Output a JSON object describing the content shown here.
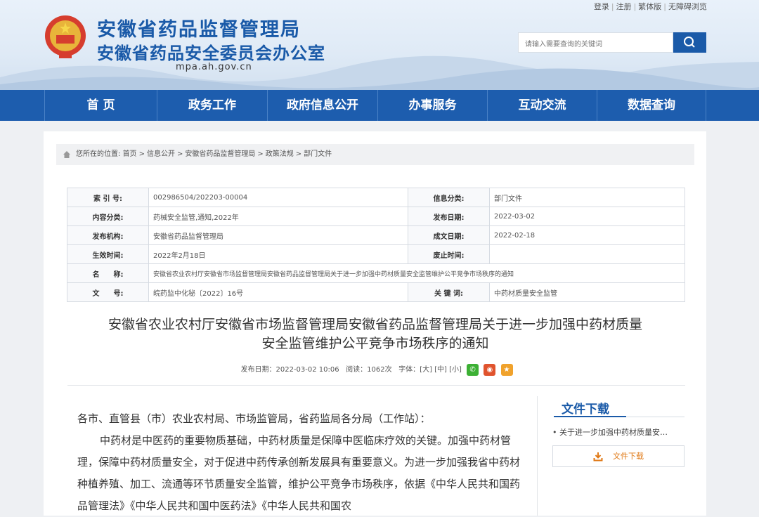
{
  "header": {
    "title": "安徽省药品监督管理局",
    "subtitle": "安徽省药品安全委员会办公室",
    "domain": "mpa.ah.gov.cn",
    "links": [
      "登录",
      "注册",
      "繁体版",
      "无障碍浏览"
    ],
    "search_placeholder": "请输入需要查询的关键词"
  },
  "nav": [
    "首 页",
    "政务工作",
    "政府信息公开",
    "办事服务",
    "互动交流",
    "数据查询"
  ],
  "breadcrumb": {
    "prefix": "您所在的位置:",
    "items": [
      "首页",
      "信息公开",
      "安徽省药品监督管理局",
      "政策法规",
      "部门文件"
    ],
    "sep": ">"
  },
  "info_table": {
    "index_label": "索 引 号:",
    "index_value": "002986504/202203-00004",
    "category_label": "信息分类:",
    "category_value": "部门文件",
    "content_label": "内容分类:",
    "content_value": "药械安全监管,通知,2022年",
    "pubdate_label": "发布日期:",
    "pubdate_value": "2022-03-02",
    "org_label": "发布机构:",
    "org_value": "安徽省药品监督管理局",
    "created_label": "成文日期:",
    "created_value": "2022-02-18",
    "effective_label": "生效时间:",
    "effective_value": "2022年2月18日",
    "repeal_label": "废止时间:",
    "repeal_value": "",
    "name_label": "名　　称:",
    "name_value": "安徽省农业农村厅安徽省市场监督管理局安徽省药品监督管理局关于进一步加强中药材质量安全监管维护公平竞争市场秩序的通知",
    "docno_label": "文　　号:",
    "docno_value": "皖药监中化秘〔2022〕16号",
    "keyword_label": "关 键 词:",
    "keyword_value": "中药材质量安全监管"
  },
  "article": {
    "title_line1": "安徽省农业农村厅安徽省市场监督管理局安徽省药品监督管理局关于进一步加强中药材质量",
    "title_line2": "安全监管维护公平竞争市场秩序的通知",
    "meta_date": "发布日期：2022-03-02 10:06",
    "meta_reads": "阅读：1062次",
    "meta_font": "字体：[大] [中] [小]",
    "salutation": "各市、直管县（市）农业农村局、市场监管局，省药监局各分局（工作站）：",
    "paragraph": "中药材是中医药的重要物质基础，中药材质量是保障中医临床疗效的关键。加强中药材管理，保障中药材质量安全，对于促进中药传承创新发展具有重要意义。为进一步加强我省中药材种植养殖、加工、流通等环节质量安全监管，维护公平竞争市场秩序，依据《中华人民共和国药品管理法》《中华人民共和国中医药法》《中华人民共和国农"
  },
  "download": {
    "title": "文件下载",
    "item": "• 关于进一步加强中药材质量安…",
    "button": "文件下载"
  },
  "colors": {
    "brand_blue": "#1d5dae",
    "accent_orange": "#e07a17"
  }
}
